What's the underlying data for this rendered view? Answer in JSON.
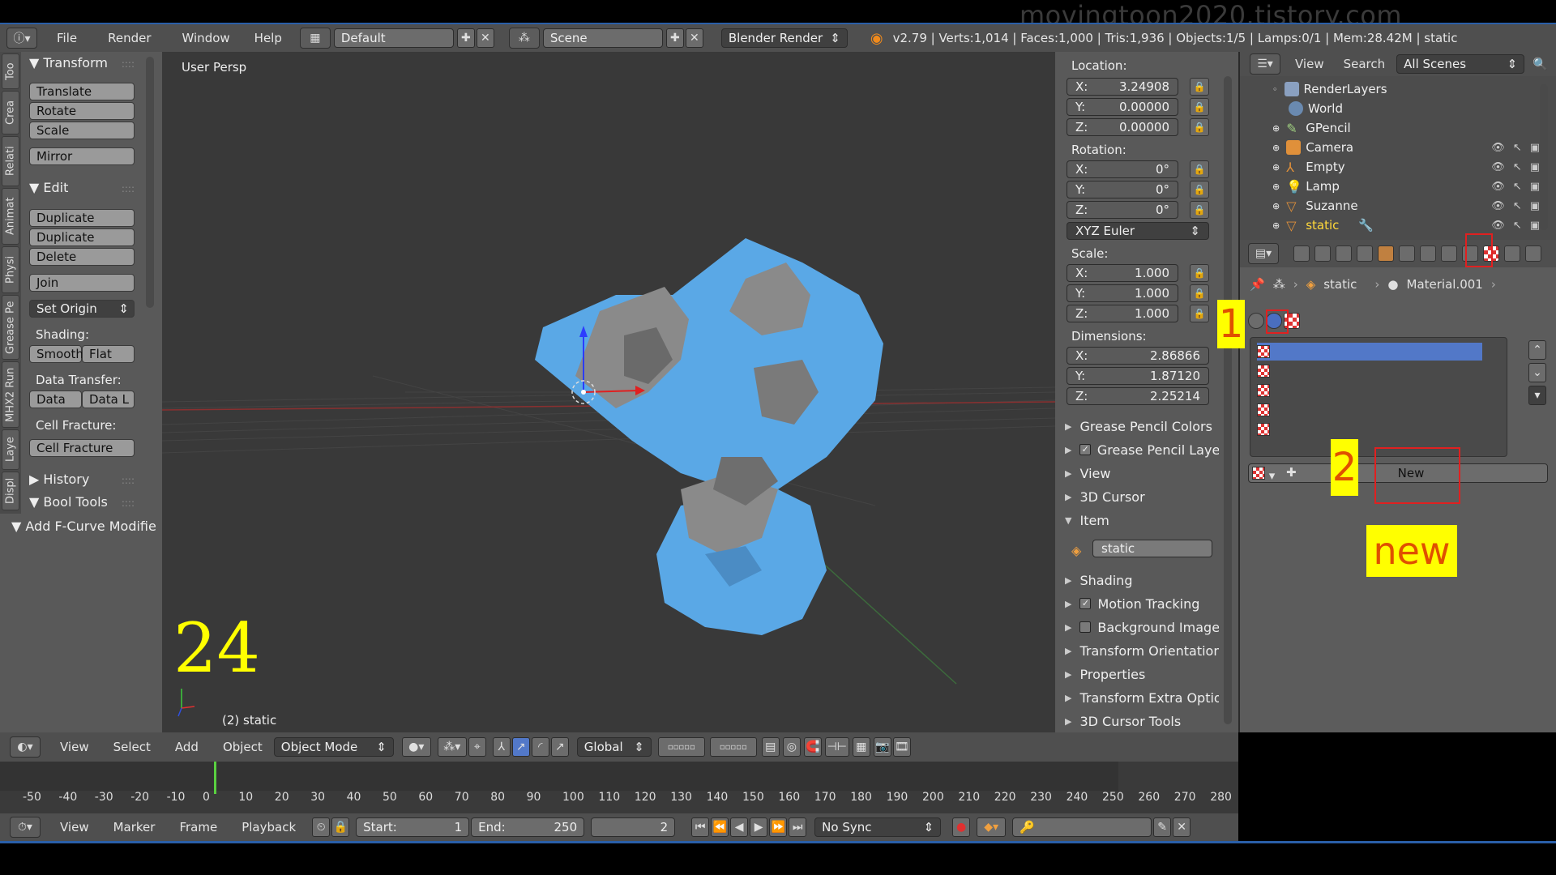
{
  "watermark": "movingtoon2020.tistory.com",
  "menu": {
    "file": "File",
    "render": "Render",
    "window": "Window",
    "help": "Help"
  },
  "layout_field": "Default",
  "scene_field": "Scene",
  "engine": "Blender Render",
  "stats": "v2.79 | Verts:1,014 | Faces:1,000 | Tris:1,936 | Objects:1/5 | Lamps:0/1 | Mem:28.42M | static",
  "vtabs": [
    "Too",
    "Crea",
    "Relati",
    "Animat",
    "Physi",
    "Grease Pe",
    "MHX2 Run",
    "Laye",
    "Displ"
  ],
  "toolshelf": {
    "transform": "Transform",
    "translate": "Translate",
    "rotate": "Rotate",
    "scale": "Scale",
    "mirror": "Mirror",
    "edit": "Edit",
    "duplicate": "Duplicate",
    "duplicate_link": "Duplicate Link...",
    "delete": "Delete",
    "join": "Join",
    "set_origin": "Set Origin",
    "shading": "Shading:",
    "smooth": "Smooth",
    "flat": "Flat",
    "data_transfer": "Data Transfer:",
    "data": "Data",
    "data_l": "Data L",
    "cell_fracture_label": "Cell Fracture:",
    "cell_fracture": "Cell Fracture",
    "history": "History",
    "bool_tools": "Bool Tools",
    "add_fcurve": "Add F-Curve Modifie"
  },
  "viewport": {
    "label": "User Persp",
    "frame_big": "24",
    "object_label": "(2) static"
  },
  "npanel": {
    "location": "Location:",
    "loc": [
      {
        "axis": "X:",
        "val": "3.24908"
      },
      {
        "axis": "Y:",
        "val": "0.00000"
      },
      {
        "axis": "Z:",
        "val": "0.00000"
      }
    ],
    "rotation": "Rotation:",
    "rot": [
      {
        "axis": "X:",
        "val": "0°"
      },
      {
        "axis": "Y:",
        "val": "0°"
      },
      {
        "axis": "Z:",
        "val": "0°"
      }
    ],
    "euler": "XYZ Euler",
    "scale": "Scale:",
    "scl": [
      {
        "axis": "X:",
        "val": "1.000"
      },
      {
        "axis": "Y:",
        "val": "1.000"
      },
      {
        "axis": "Z:",
        "val": "1.000"
      }
    ],
    "dimensions": "Dimensions:",
    "dim": [
      {
        "axis": "X:",
        "val": "2.86866"
      },
      {
        "axis": "Y:",
        "val": "1.87120"
      },
      {
        "axis": "Z:",
        "val": "2.25214"
      }
    ],
    "gp_colors": "Grease Pencil Colors",
    "gp_layers": "Grease Pencil Layer",
    "view": "View",
    "cursor3d": "3D Cursor",
    "item": "Item",
    "item_name": "static",
    "shading": "Shading",
    "motion": "Motion Tracking",
    "bgimage": "Background Image",
    "transform_orient": "Transform Orientation",
    "properties": "Properties",
    "transform_extra": "Transform Extra Optio",
    "cursor_tools": "3D Cursor Tools"
  },
  "outliner": {
    "view": "View",
    "search": "Search",
    "scenes": "All Scenes",
    "items": [
      "RenderLayers",
      "World",
      "GPencil",
      "Camera",
      "Empty",
      "Lamp",
      "Suzanne",
      "static"
    ]
  },
  "props": {
    "breadcrumb_obj": "static",
    "breadcrumb_mat": "Material.001",
    "new_btn": "New",
    "anno1": "1",
    "anno2": "2",
    "anno_new": "new"
  },
  "view3d_header": {
    "view": "View",
    "select": "Select",
    "add": "Add",
    "object": "Object",
    "mode": "Object Mode",
    "orientation": "Global"
  },
  "ruler": [
    "-50",
    "-40",
    "-30",
    "-20",
    "-10",
    "0",
    "10",
    "20",
    "30",
    "40",
    "50",
    "60",
    "70",
    "80",
    "90",
    "100",
    "110",
    "120",
    "130",
    "140",
    "150",
    "160",
    "170",
    "180",
    "190",
    "200",
    "210",
    "220",
    "230",
    "240",
    "250",
    "260",
    "270",
    "280"
  ],
  "timeline": {
    "view": "View",
    "marker": "Marker",
    "frame": "Frame",
    "playback": "Playback",
    "start_label": "Start:",
    "start": "1",
    "end_label": "End:",
    "end": "250",
    "current": "2",
    "sync": "No Sync"
  }
}
